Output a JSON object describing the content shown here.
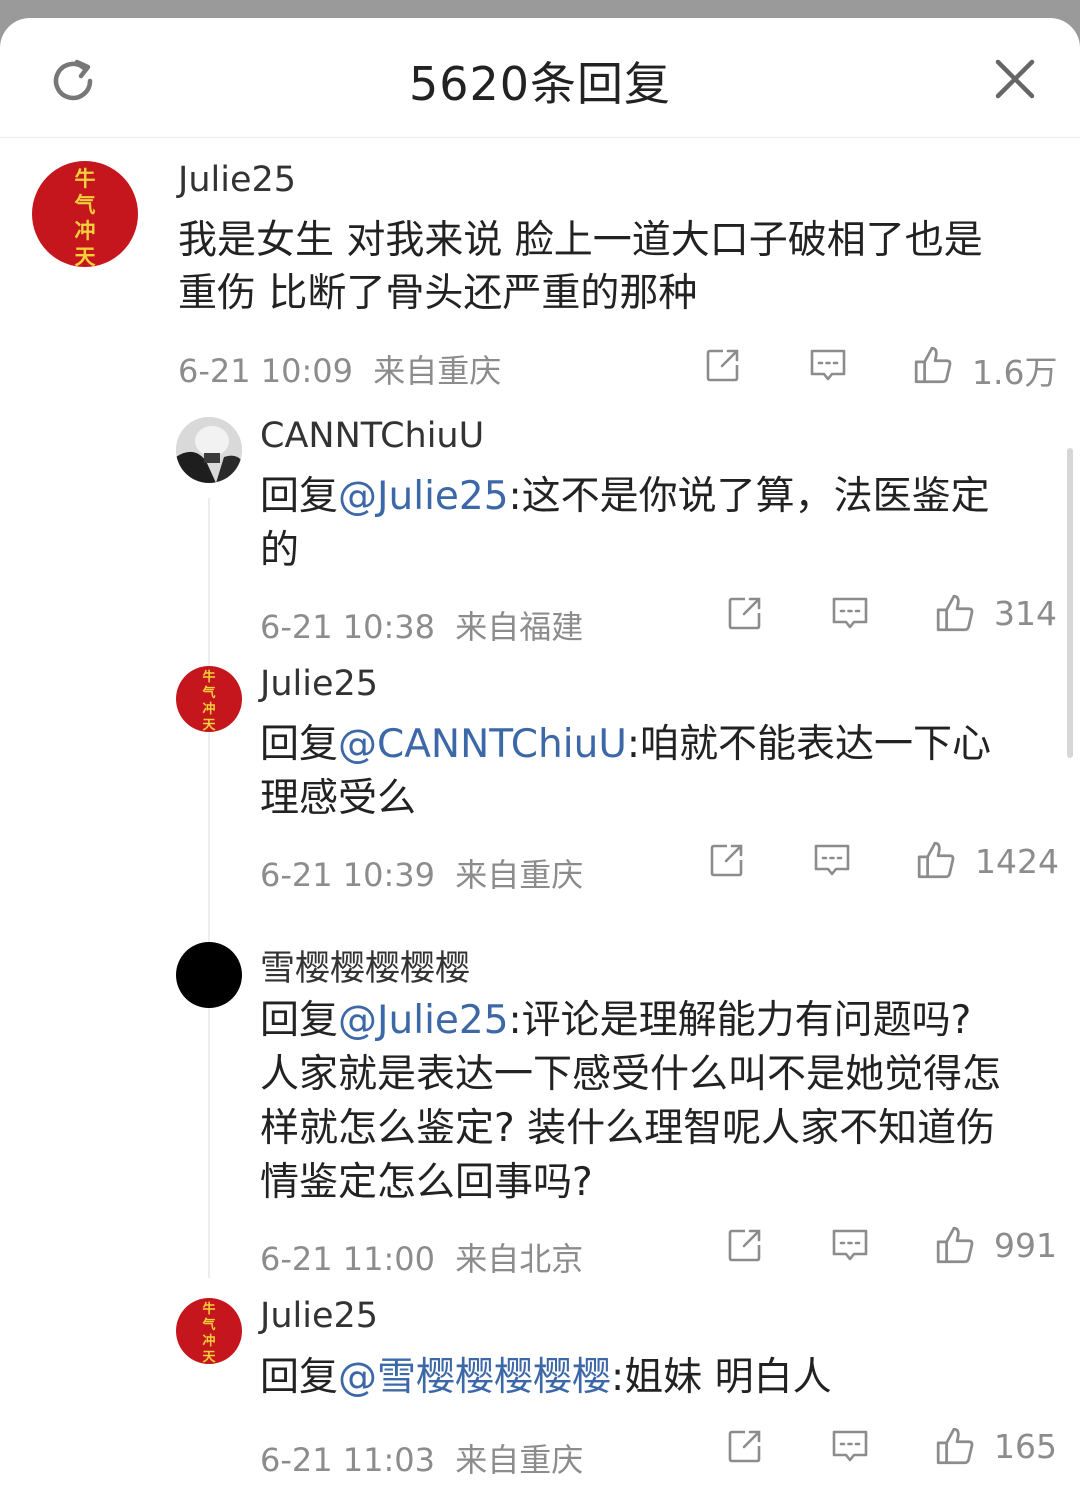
{
  "header": {
    "title": "5620条回复",
    "refresh_icon": "refresh-icon",
    "close_icon": "close-icon"
  },
  "main_comment": {
    "avatar_text": [
      "牛",
      "气",
      "冲",
      "天"
    ],
    "username": "Julie25",
    "lines": [
      "我是女生 对我来说 脸上一道大口子破相了也是",
      "重伤 比断了骨头还严重的那种"
    ],
    "time": "6-21 10:09",
    "location": "来自重庆",
    "likes": "1.6万"
  },
  "replies": [
    {
      "username": "CANNTChiuU",
      "reply_prefix": "回复",
      "mention": "@Julie25",
      "line1_rest": ":这不是你说了算，法医鉴定",
      "more_lines": [
        "的"
      ],
      "time": "6-21 10:38",
      "location": "来自福建",
      "likes": "314"
    },
    {
      "username": "Julie25",
      "avatar_text": [
        "牛",
        "气",
        "冲",
        "天"
      ],
      "reply_prefix": "回复",
      "mention": "@CANNTChiuU",
      "line1_rest": ":咱就不能表达一下心",
      "more_lines": [
        "理感受么"
      ],
      "time": "6-21 10:39",
      "location": "来自重庆",
      "likes": "1424"
    },
    {
      "username": "雪樱樱樱樱樱",
      "reply_prefix": "回复",
      "mention": "@Julie25",
      "line1_rest": ":评论是理解能力有问题吗?",
      "more_lines": [
        "人家就是表达一下感受什么叫不是她觉得怎",
        "样就怎么鉴定? 装什么理智呢人家不知道伤",
        "情鉴定怎么回事吗?"
      ],
      "time": "6-21 11:00",
      "location": "来自北京",
      "likes": "991"
    },
    {
      "username": "Julie25",
      "avatar_text": [
        "牛",
        "气",
        "冲",
        "天"
      ],
      "reply_prefix": "回复",
      "mention": "@雪樱樱樱樱樱",
      "line1_rest": ":姐妹 明白人",
      "more_lines": [],
      "time": "6-21 11:03",
      "location": "来自重庆",
      "likes": "165"
    }
  ],
  "action_icons": [
    "share-icon",
    "comment-icon",
    "thumbs-up-icon"
  ]
}
